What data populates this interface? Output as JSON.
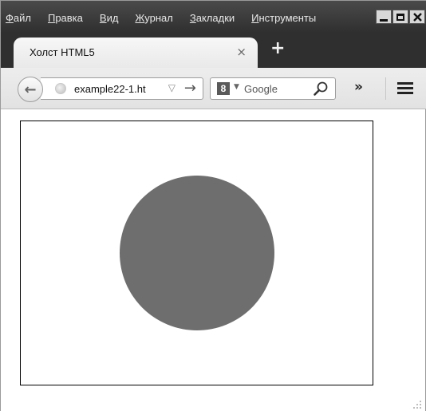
{
  "menubar": {
    "items": [
      {
        "first": "Ф",
        "rest": "айл"
      },
      {
        "first": "П",
        "rest": "равка"
      },
      {
        "first": "В",
        "rest": "ид"
      },
      {
        "first": "Ж",
        "rest": "урнал"
      },
      {
        "first": "З",
        "rest": "акладки"
      },
      {
        "first": "И",
        "rest": "нструменты"
      }
    ]
  },
  "tab": {
    "title": "Холст HTML5",
    "close": "×"
  },
  "newtab": "+",
  "nav": {
    "back_icon": "←",
    "url": "example22-1.ht",
    "dropmark": "▽",
    "go": "→"
  },
  "search": {
    "engine_letter": "8",
    "engine_drop": "▼",
    "placeholder": "Google"
  },
  "toolbar": {
    "overflow": "»"
  },
  "canvas": {
    "circle_color": "#6e6e6e",
    "border_color": "#000000"
  }
}
